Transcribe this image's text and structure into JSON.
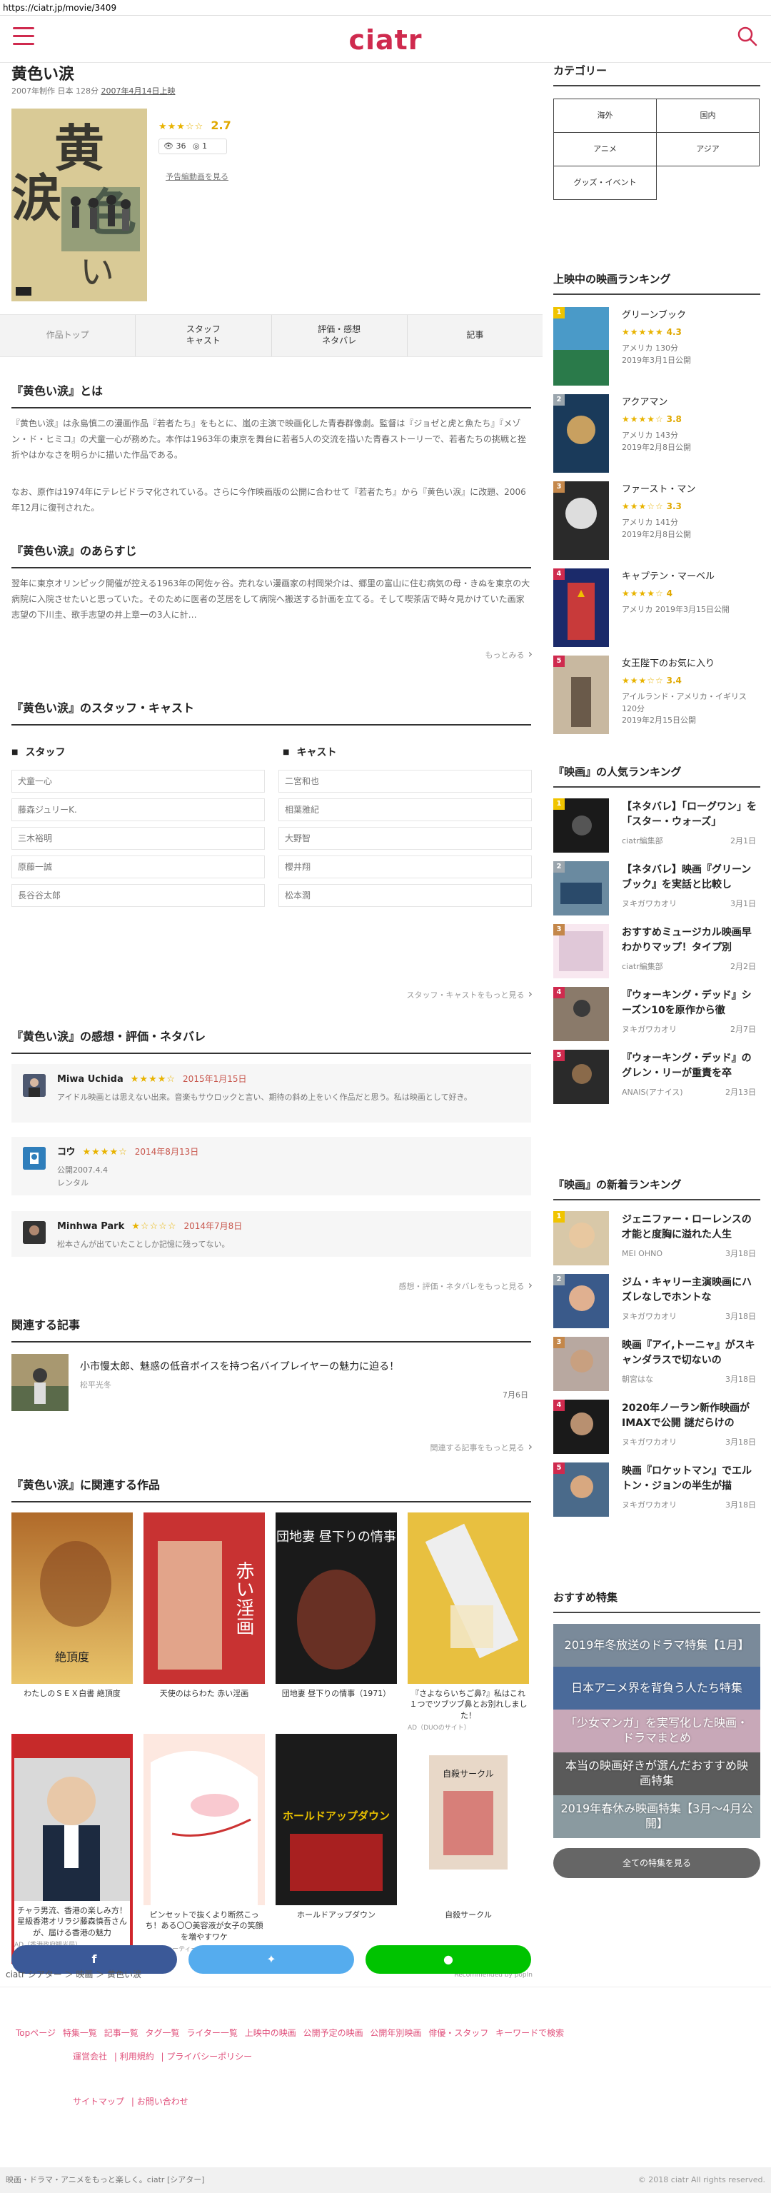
{
  "url": "https://ciatr.jp/movie/3409",
  "logo": "ciatr",
  "movie": {
    "title": "黄色い涙",
    "meta": "2007年制作 日本 128分",
    "release": "2007年4月14日上映",
    "stars": "★★★☆☆",
    "score": "2.7",
    "views": "36",
    "clips": "1",
    "trailer_link": "予告編動画を見る"
  },
  "tabs": [
    "作品トップ",
    "スタッフ\nキャスト",
    "評価・感想\nネタバレ",
    "記事"
  ],
  "about": {
    "heading": "『黄色い涙』とは",
    "p1": "『黄色い涙』は永島慎二の漫画作品『若者たち』をもとに、嵐の主演で映画化した青春群像劇。監督は『ジョゼと虎と魚たち』『メゾン・ド・ヒミコ』の犬童一心が務めた。本作は1963年の東京を舞台に若者5人の交流を描いた青春ストーリーで、若者たちの挑戦と挫折やはかなさを明らかに描いた作品である。",
    "p2": "なお、原作は1974年にテレビドラマ化されている。さらに今作映画版の公開に合わせて『若者たち』から『黄色い涙』に改題、2006年12月に復刊された。"
  },
  "synopsis": {
    "heading": "『黄色い涙』のあらすじ",
    "text": "翌年に東京オリンピック開催が控える1963年の阿佐ヶ谷。売れない漫画家の村岡栄介は、郷里の富山に住む病気の母・きぬを東京の大病院に入院させたいと思っていた。そのために医者の芝居をして病院へ搬送する計画を立てる。そして喫茶店で時々見かけていた画家志望の下川圭、歌手志望の井上章一の3人に計…",
    "more": "もっとみる"
  },
  "staffcast": {
    "heading": "『黄色い涙』のスタッフ・キャスト",
    "staff_label": "スタッフ",
    "cast_label": "キャスト",
    "staff": [
      "犬童一心",
      "藤森ジュリーK.",
      "三木裕明",
      "原藤一誠",
      "長谷谷太郎"
    ],
    "cast": [
      "二宮和也",
      "相葉雅紀",
      "大野智",
      "櫻井翔",
      "松本潤"
    ],
    "more": "スタッフ・キャストをもっと見る"
  },
  "reviews": {
    "heading": "『黄色い涙』の感想・評価・ネタバレ",
    "items": [
      {
        "name": "Miwa Uchida",
        "stars": "★★★★☆",
        "date": "2015年1月15日",
        "text": "アイドル映画とは思えない出来。音楽もサウロックと言い、期待の斜め上をいく作品だと思う。私は映画として好き。"
      },
      {
        "name": "コウ",
        "stars": "★★★★☆",
        "date": "2014年8月13日",
        "text": "公開2007.4.4\nレンタル"
      },
      {
        "name": "Minhwa Park",
        "stars": "★☆☆☆☆",
        "date": "2014年7月8日",
        "text": "松本さんが出ていたことしか記憶に残ってない。"
      }
    ],
    "more": "感想・評価・ネタバレをもっと見る"
  },
  "related_articles": {
    "heading": "関連する記事",
    "title": "小市慢太郎、魅惑の低音ボイスを持つ名バイプレイヤーの魅力に迫る！",
    "author": "松平光冬",
    "date": "7月6日",
    "more": "関連する記事をもっと見る"
  },
  "related_works": {
    "heading": "『黄色い涙』に関連する作品",
    "items": [
      {
        "label": "わたしのＳＥＸ白書 絶頂度",
        "sub": ""
      },
      {
        "label": "天使のはらわた 赤い淫画",
        "sub": ""
      },
      {
        "label": "団地妻 昼下りの情事（1971）",
        "sub": ""
      },
      {
        "label": "『さよならいちご鼻?』私はこれ１つでツブツブ鼻とお別れしました！",
        "sub": "AD（DUOのサイト）"
      },
      {
        "label": "チャラ男流、香港の楽しみ方！星級香港オリラジ藤森慎吾さんが、届ける香港の魅力",
        "sub": "AD（香港政府観光局）"
      },
      {
        "label": "ピンセットで抜くより断然こっち！ある〇〇美容液が女子の笑顔を増やすワケ",
        "sub": "AD（ビューティーラボ）"
      },
      {
        "label": "ホールドアップダウン",
        "sub": ""
      },
      {
        "label": "自殺サークル",
        "sub": ""
      }
    ],
    "poster_texts": [
      "絶頂度",
      "赤い淫画",
      "団地妻 昼下りの情事",
      "ホールドアップダウン",
      "自殺サークル"
    ],
    "recommended": "Recommended by popIn"
  },
  "breadcrumb": "ciatr シアター ＞ 映画 ＞ 黄色い涙",
  "footer": {
    "links1": [
      "Topページ",
      "特集一覧",
      "記事一覧",
      "タグ一覧",
      "ライター一覧",
      "上映中の映画",
      "公開予定の映画",
      "公開年別映画",
      "俳優・スタッフ",
      "キーワードで検索"
    ],
    "links2": [
      "運営会社",
      "利用規約",
      "プライバシーポリシー"
    ],
    "links3": [
      "サイトマップ",
      "お問い合わせ"
    ],
    "tagline": "映画・ドラマ・アニメをもっと楽しく。ciatr [シアター]",
    "copyright": "© 2018 ciatr All rights reserved."
  },
  "sidebar": {
    "categories_heading": "カテゴリー",
    "categories": [
      "海外",
      "国内",
      "アニメ",
      "アジア",
      "グッズ・イベント"
    ],
    "ranking_heading": "上映中の映画ランキング",
    "ranking": [
      {
        "title": "グリーンブック",
        "stars": "★★★★★",
        "score": "4.3",
        "meta": "アメリカ 130分\n2019年3月1日公開"
      },
      {
        "title": "アクアマン",
        "stars": "★★★★☆",
        "score": "3.8",
        "meta": "アメリカ 143分\n2019年2月8日公開"
      },
      {
        "title": "ファースト・マン",
        "stars": "★★★☆☆",
        "score": "3.3",
        "meta": "アメリカ 141分\n2019年2月8日公開"
      },
      {
        "title": "キャプテン・マーベル",
        "stars": "★★★★☆",
        "score": "4",
        "meta": "アメリカ 2019年3月15日公開"
      },
      {
        "title": "女王陛下のお気に入り",
        "stars": "★★★☆☆",
        "score": "3.4",
        "meta": "アイルランド・アメリカ・イギリス 120分\n2019年2月15日公開"
      }
    ],
    "popular_heading": "『映画』の人気ランキング",
    "popular": [
      {
        "title": "【ネタバレ】「ローグワン」を「スター・ウォーズ」",
        "author": "ciatr編集部",
        "date": "2月1日"
      },
      {
        "title": "【ネタバレ】映画『グリーンブック』を実話と比較し",
        "author": "ヌキガワカオリ",
        "date": "3月1日"
      },
      {
        "title": "おすすめミュージカル映画早わかりマップ！タイプ別",
        "author": "ciatr編集部",
        "date": "2月2日"
      },
      {
        "title": "『ウォーキング・デッド』シーズン10を原作から徹",
        "author": "ヌキガワカオリ",
        "date": "2月7日"
      },
      {
        "title": "『ウォーキング・デッド』のグレン・リーが重責を卒",
        "author": "ANAIS(アナイス)",
        "date": "2月13日"
      }
    ],
    "new_heading": "『映画』の新着ランキング",
    "new": [
      {
        "title": "ジェニファー・ローレンスの才能と度胸に溢れた人生",
        "author": "MEI OHNO",
        "date": "3月18日"
      },
      {
        "title": "ジム・キャリー主演映画にハズレなしでホントな",
        "author": "ヌキガワカオリ",
        "date": "3月18日"
      },
      {
        "title": "映画『アイ,トーニャ』がスキャンダラスで切ないの",
        "author": "朝宮はな",
        "date": "3月18日"
      },
      {
        "title": "2020年ノーラン新作映画がIMAXで公開 謎だらけの",
        "author": "ヌキガワカオリ",
        "date": "3月18日"
      },
      {
        "title": "映画『ロケットマン』でエルトン・ジョンの半生が描",
        "author": "ヌキガワカオリ",
        "date": "3月18日"
      }
    ],
    "features_heading": "おすすめ特集",
    "features": [
      "2019年冬放送のドラマ特集【1月】",
      "日本アニメ界を背負う人たち特集",
      "「少女マンガ」を実写化した映画・ドラマまとめ",
      "本当の映画好きが選んだおすすめ映画特集",
      "2019年春休み映画特集【3月〜4月公開】"
    ],
    "all_features": "全ての特集を見る"
  },
  "colors": {
    "brand": "#cf2a4e",
    "facebook": "#3b5998",
    "twitter": "#55acee",
    "line": "#00c300"
  }
}
